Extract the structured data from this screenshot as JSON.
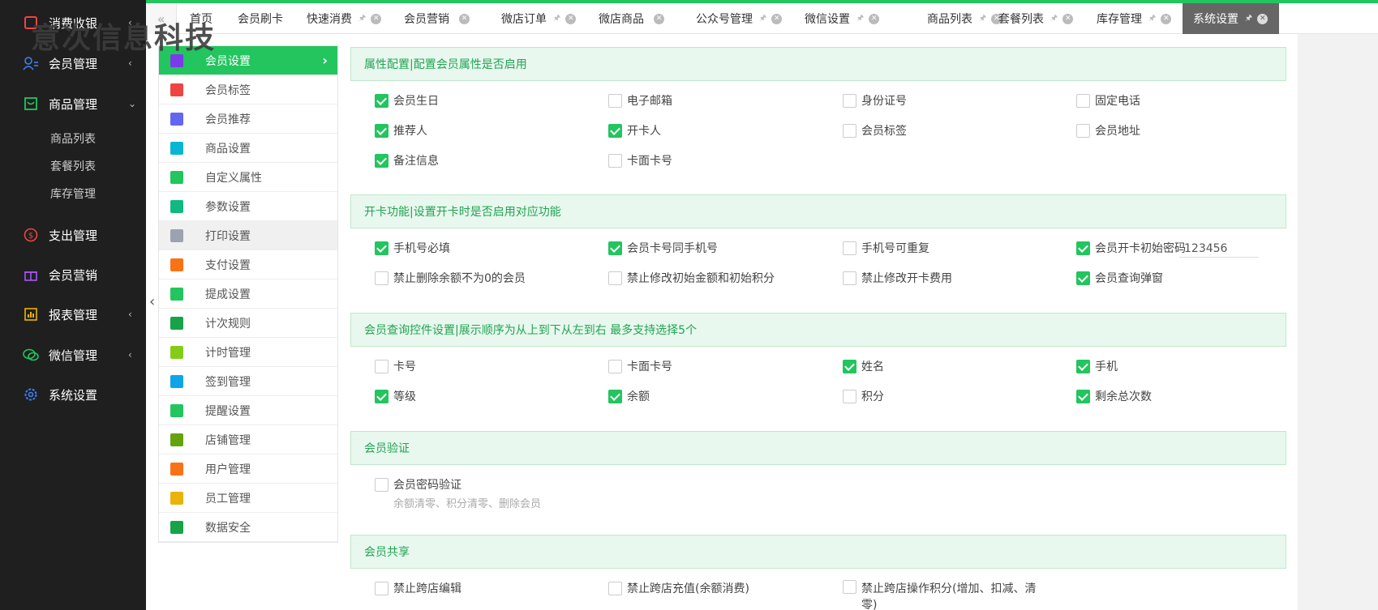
{
  "watermark": "意次信息科技",
  "sidebar": {
    "items": [
      {
        "label": "消费收银",
        "arrow": "‹"
      },
      {
        "label": "会员管理",
        "arrow": "‹"
      },
      {
        "label": "商品管理",
        "arrow": "⌄"
      },
      {
        "label": "支出管理",
        "arrow": ""
      },
      {
        "label": "会员营销",
        "arrow": ""
      },
      {
        "label": "报表管理",
        "arrow": "‹"
      },
      {
        "label": "微信管理",
        "arrow": "‹"
      },
      {
        "label": "系统设置",
        "arrow": ""
      }
    ],
    "subitems": [
      "商品列表",
      "套餐列表",
      "库存管理"
    ]
  },
  "tabs": [
    {
      "label": "首页"
    },
    {
      "label": "会员刷卡"
    },
    {
      "label": "快速消费"
    },
    {
      "label": "会员营销"
    },
    {
      "label": "微店订单"
    },
    {
      "label": "微店商品"
    },
    {
      "label": "公众号管理"
    },
    {
      "label": "微信设置"
    },
    {
      "label": "商品列表"
    },
    {
      "label": "套餐列表"
    },
    {
      "label": "库存管理"
    },
    {
      "label": "系统设置"
    }
  ],
  "submenu": [
    {
      "label": "会员设置",
      "color": "#8b5cf6"
    },
    {
      "label": "会员标签",
      "color": "#ef4444"
    },
    {
      "label": "会员推荐",
      "color": "#6366f1"
    },
    {
      "label": "商品设置",
      "color": "#06b6d4"
    },
    {
      "label": "自定义属性",
      "color": "#22c55e"
    },
    {
      "label": "参数设置",
      "color": "#10b981"
    },
    {
      "label": "打印设置",
      "color": "#9ca3af"
    },
    {
      "label": "支付设置",
      "color": "#f97316"
    },
    {
      "label": "提成设置",
      "color": "#22c55e"
    },
    {
      "label": "计次规则",
      "color": "#16a34a"
    },
    {
      "label": "计时管理",
      "color": "#84cc16"
    },
    {
      "label": "签到管理",
      "color": "#0ea5e9"
    },
    {
      "label": "提醒设置",
      "color": "#22c55e"
    },
    {
      "label": "店铺管理",
      "color": "#65a30d"
    },
    {
      "label": "用户管理",
      "color": "#f97316"
    },
    {
      "label": "员工管理",
      "color": "#eab308"
    },
    {
      "label": "数据安全",
      "color": "#16a34a"
    }
  ],
  "sections": {
    "attr": {
      "title": "属性配置|配置会员属性是否启用",
      "options": [
        {
          "label": "会员生日",
          "checked": true
        },
        {
          "label": "电子邮箱",
          "checked": false
        },
        {
          "label": "身份证号",
          "checked": false
        },
        {
          "label": "固定电话",
          "checked": false
        },
        {
          "label": "推荐人",
          "checked": true
        },
        {
          "label": "开卡人",
          "checked": true
        },
        {
          "label": "会员标签",
          "checked": false
        },
        {
          "label": "会员地址",
          "checked": false
        },
        {
          "label": "备注信息",
          "checked": true
        },
        {
          "label": "卡面卡号",
          "checked": false
        }
      ]
    },
    "card": {
      "title": "开卡功能|设置开卡时是否启用对应功能",
      "options": [
        {
          "label": "手机号必填",
          "checked": true
        },
        {
          "label": "会员卡号同手机号",
          "checked": true
        },
        {
          "label": "手机号可重复",
          "checked": false
        },
        {
          "label": "会员开卡初始密码",
          "checked": true
        },
        {
          "label": "禁止删除余额不为0的会员",
          "checked": false
        },
        {
          "label": "禁止修改初始金额和初始积分",
          "checked": false
        },
        {
          "label": "禁止修改开卡费用",
          "checked": false
        },
        {
          "label": "会员查询弹窗",
          "checked": true
        }
      ],
      "init_password": "123456"
    },
    "query": {
      "title": "会员查询控件设置|展示顺序为从上到下从左到右 最多支持选择5个",
      "options": [
        {
          "label": "卡号",
          "checked": false
        },
        {
          "label": "卡面卡号",
          "checked": false
        },
        {
          "label": "姓名",
          "checked": true
        },
        {
          "label": "手机",
          "checked": true
        },
        {
          "label": "等级",
          "checked": true
        },
        {
          "label": "余额",
          "checked": true
        },
        {
          "label": "积分",
          "checked": false
        },
        {
          "label": "剩余总次数",
          "checked": true
        }
      ]
    },
    "verify": {
      "title": "会员验证",
      "options": [
        {
          "label": "会员密码验证",
          "checked": false
        }
      ],
      "hint": "余额清零、积分清零、删除会员"
    },
    "share": {
      "title": "会员共享",
      "options": [
        {
          "label": "禁止跨店编辑",
          "checked": false
        },
        {
          "label": "禁止跨店充值(余额消费)",
          "checked": false
        },
        {
          "label": "禁止跨店操作积分(增加、扣减、清零)",
          "checked": false
        }
      ]
    }
  }
}
